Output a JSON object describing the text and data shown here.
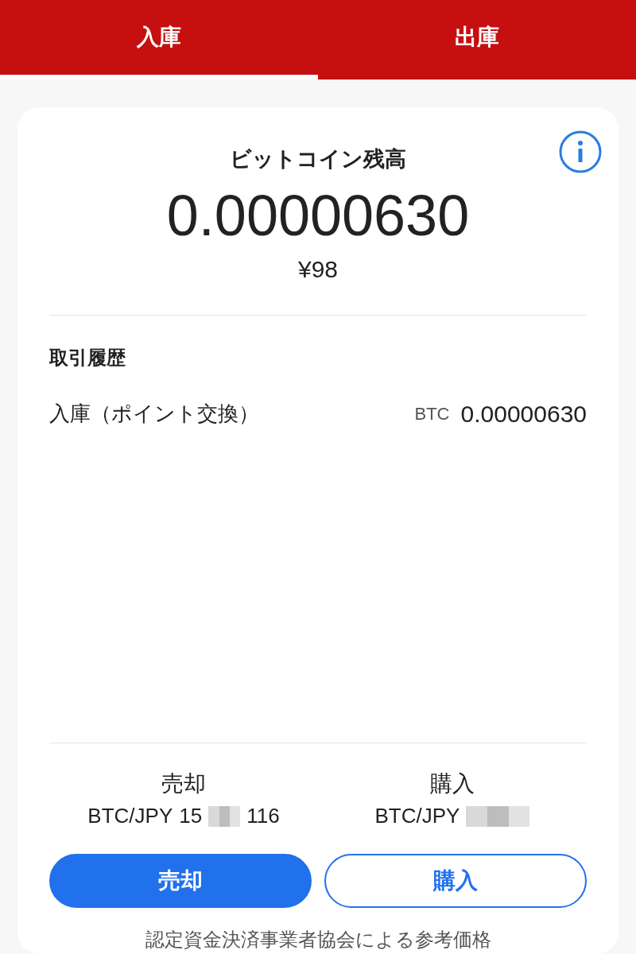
{
  "tabs": [
    {
      "label": "入庫",
      "selected": true
    },
    {
      "label": "出庫",
      "selected": false
    }
  ],
  "balance": {
    "title": "ビットコイン残高",
    "amount": "0.00000630",
    "fiat": "¥98"
  },
  "history": {
    "title": "取引履歴",
    "rows": [
      {
        "label": "入庫（ポイント交換）",
        "unit": "BTC",
        "amount": "0.00000630"
      }
    ]
  },
  "prices": [
    {
      "label": "売却",
      "pair": "BTC/JPY",
      "value_start": "15",
      "value_end": "116"
    },
    {
      "label": "購入",
      "pair": "BTC/JPY"
    }
  ],
  "buttons": [
    {
      "label": "売却",
      "kind": "filled"
    },
    {
      "label": "購入",
      "kind": "outline"
    }
  ],
  "footnote": "認定資金決済事業者協会による参考価格"
}
